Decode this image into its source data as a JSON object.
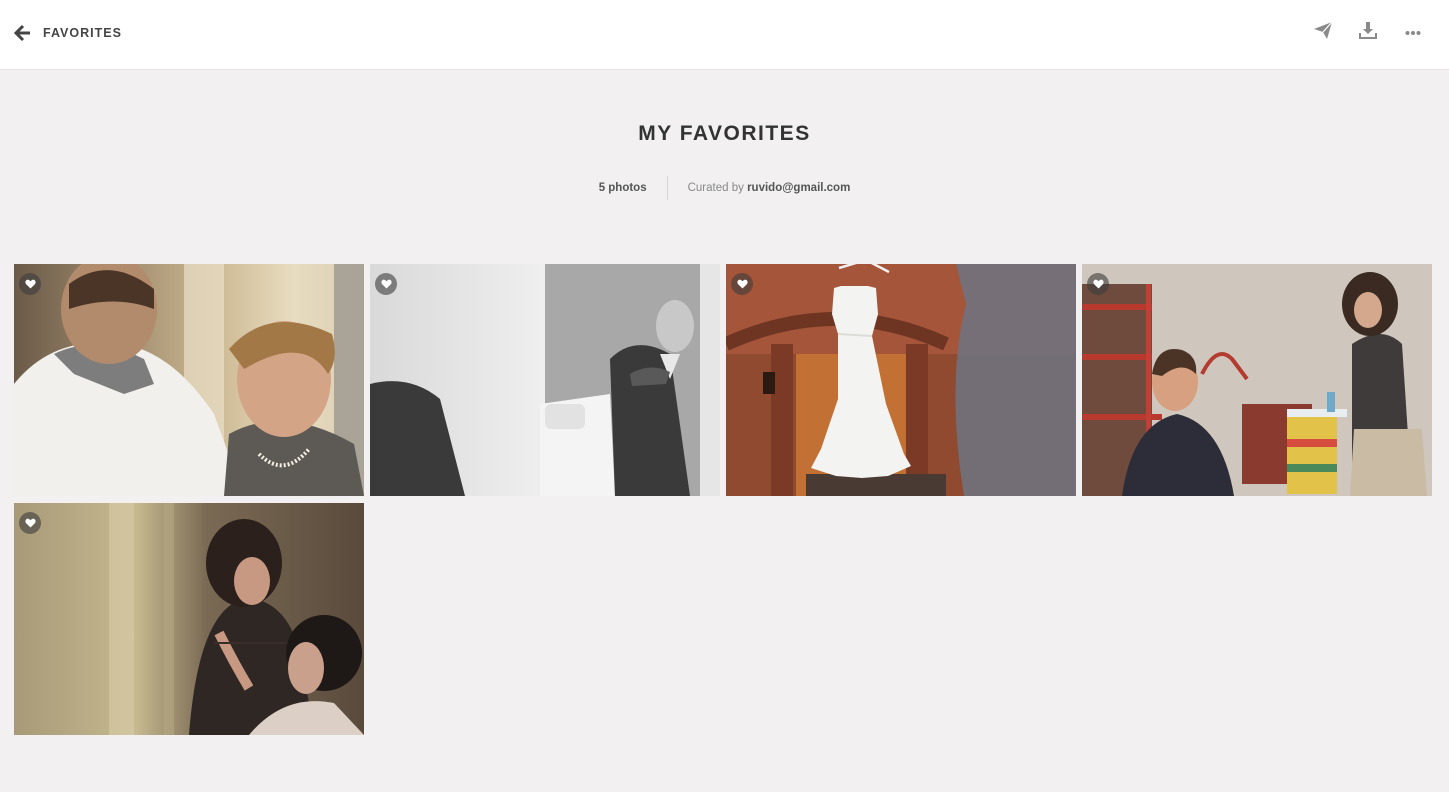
{
  "header": {
    "back_label": "FAVORITES",
    "icons": [
      "arrow-left-icon",
      "send-icon",
      "download-icon",
      "more-icon"
    ]
  },
  "gallery": {
    "title": "MY FAVORITES",
    "photo_count": "5 photos",
    "curated_prefix": "Curated by",
    "curator_email": "ruvido@gmail.com",
    "photos": [
      {
        "subject": "groom with older woman",
        "favorited": true
      },
      {
        "subject": "groom adjusting tie",
        "favorited": true
      },
      {
        "subject": "wedding dress on hanger",
        "favorited": true
      },
      {
        "subject": "laughing woman in bedroom",
        "favorited": true
      },
      {
        "subject": "makeup artist with bride",
        "favorited": true
      }
    ]
  },
  "colors": {
    "background": "#f2f0f1",
    "topbar": "#ffffff",
    "text": "#333333",
    "icon": "#8a8a8a"
  }
}
